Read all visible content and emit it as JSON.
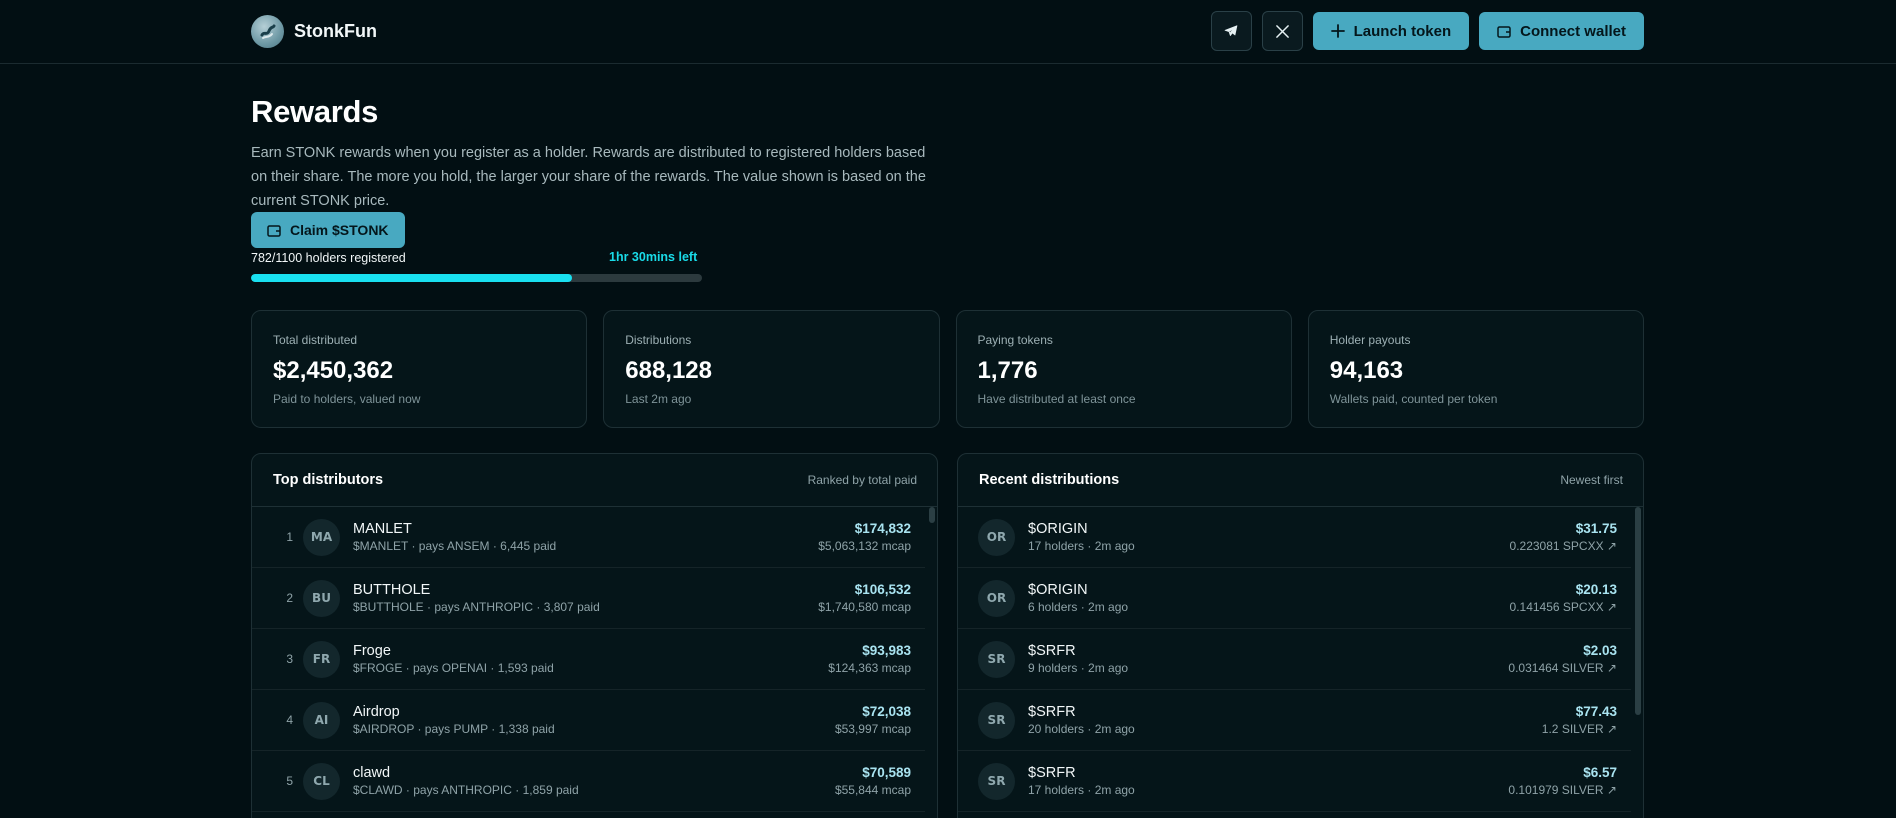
{
  "header": {
    "brand": "StonkFun",
    "launch_label": "Launch token",
    "connect_label": "Connect wallet"
  },
  "page": {
    "title": "Rewards",
    "intro": "Earn STONK rewards when you register as a holder. Rewards are distributed to registered holders based on their share. The more you hold, the larger your share of the rewards. The value shown is based on the current STONK price.",
    "claim_label": "Claim $STONK",
    "registered": "782/1100 holders registered",
    "time_left": "1hr 30mins left",
    "progress_fraction": 0.711
  },
  "stats": [
    {
      "label": "Total distributed",
      "value": "$2,450,362",
      "sub": "Paid to holders, valued now"
    },
    {
      "label": "Distributions",
      "value": "688,128",
      "sub": "Last 2m ago"
    },
    {
      "label": "Paying tokens",
      "value": "1,776",
      "sub": "Have distributed at least once"
    },
    {
      "label": "Holder payouts",
      "value": "94,163",
      "sub": "Wallets paid, counted per token"
    }
  ],
  "top_distributors": {
    "title": "Top distributors",
    "note": "Ranked by total paid",
    "rows": [
      {
        "rank": "1",
        "initials": "MA",
        "name": "MANLET",
        "sub": "$MANLET · pays ANSEM · 6,445 paid",
        "amount": "$174,832",
        "meta": "$5,063,132 mcap"
      },
      {
        "rank": "2",
        "initials": "BU",
        "name": "BUTTHOLE",
        "sub": "$BUTTHOLE · pays ANTHROPIC · 3,807 paid",
        "amount": "$106,532",
        "meta": "$1,740,580 mcap"
      },
      {
        "rank": "3",
        "initials": "FR",
        "name": "Froge",
        "sub": "$FROGE · pays OPENAI · 1,593 paid",
        "amount": "$93,983",
        "meta": "$124,363 mcap"
      },
      {
        "rank": "4",
        "initials": "AI",
        "name": "Airdrop",
        "sub": "$AIRDROP · pays PUMP · 1,338 paid",
        "amount": "$72,038",
        "meta": "$53,997 mcap"
      },
      {
        "rank": "5",
        "initials": "CL",
        "name": "clawd",
        "sub": "$CLAWD · pays ANTHROPIC · 1,859 paid",
        "amount": "$70,589",
        "meta": "$55,844 mcap"
      }
    ]
  },
  "recent_distributions": {
    "title": "Recent distributions",
    "note": "Newest first",
    "rows": [
      {
        "initials": "OR",
        "name": "$ORIGIN",
        "sub": "17 holders · 2m ago",
        "amount": "$31.75",
        "meta": "0.223081 SPCXX ↗"
      },
      {
        "initials": "OR",
        "name": "$ORIGIN",
        "sub": "6 holders · 2m ago",
        "amount": "$20.13",
        "meta": "0.141456 SPCXX ↗"
      },
      {
        "initials": "SR",
        "name": "$SRFR",
        "sub": "9 holders · 2m ago",
        "amount": "$2.03",
        "meta": "0.031464 SILVER ↗"
      },
      {
        "initials": "SR",
        "name": "$SRFR",
        "sub": "20 holders · 2m ago",
        "amount": "$77.43",
        "meta": "1.2 SILVER ↗"
      },
      {
        "initials": "SR",
        "name": "$SRFR",
        "sub": "17 holders · 2m ago",
        "amount": "$6.57",
        "meta": "0.101979 SILVER ↗"
      }
    ]
  }
}
